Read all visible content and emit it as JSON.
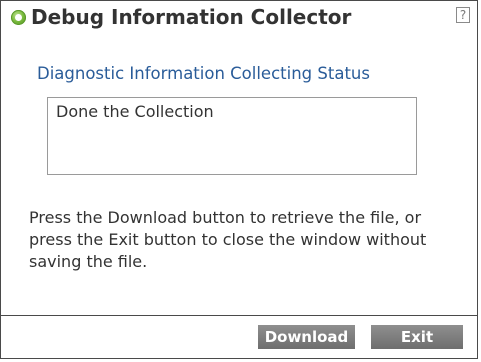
{
  "dialog": {
    "title": "Debug Information Collector",
    "title_icon": "green-circle-icon",
    "help": {
      "icon": "question-mark-icon",
      "label": "?"
    }
  },
  "status": {
    "label": "Diagnostic Information Collecting Status",
    "value": "Done the Collection"
  },
  "message": "Press the Download button to retrieve the file, or press the Exit button to close the window without saving the file.",
  "buttons": {
    "download": "Download",
    "exit": "Exit"
  },
  "colors": {
    "label_blue": "#2a5c99",
    "button_gray": "#7f7f7f",
    "icon_green": "#7cbc3f"
  }
}
